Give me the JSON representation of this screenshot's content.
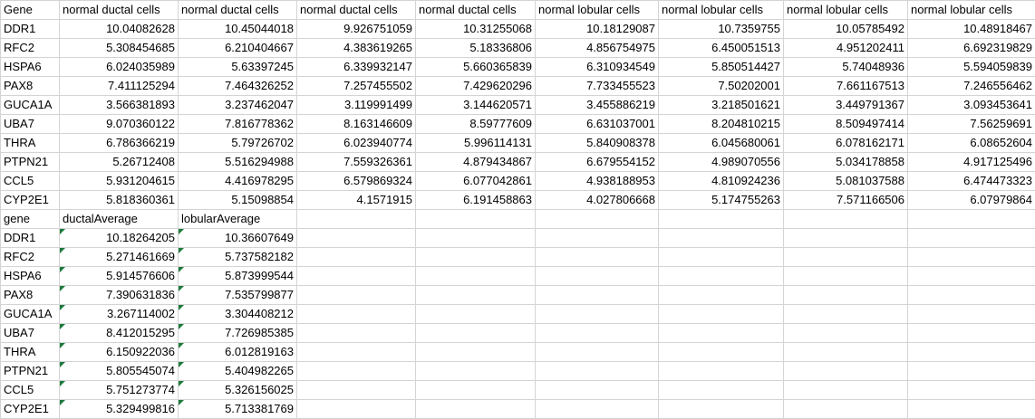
{
  "sheet": {
    "header_row": [
      "Gene",
      "normal ductal cells",
      "normal ductal cells",
      "normal ductal cells",
      "normal ductal cells",
      "normal lobular cells",
      "normal lobular cells",
      "normal lobular cells",
      "normal lobular cells"
    ],
    "rows": [
      [
        "DDR1",
        "10.04082628",
        "10.45044018",
        "9.926751059",
        "10.31255068",
        "10.18129087",
        "10.7359755",
        "10.05785492",
        "10.48918467"
      ],
      [
        "RFC2",
        "5.308454685",
        "6.210404667",
        "4.383619265",
        "5.18336806",
        "4.856754975",
        "6.450051513",
        "4.951202411",
        "6.692319829"
      ],
      [
        "HSPA6",
        "6.024035989",
        "5.63397245",
        "6.339932147",
        "5.660365839",
        "6.310934549",
        "5.850514427",
        "5.74048936",
        "5.594059839"
      ],
      [
        "PAX8",
        "7.411125294",
        "7.464326252",
        "7.257455502",
        "7.429620296",
        "7.733455523",
        "7.50202001",
        "7.661167513",
        "7.246556462"
      ],
      [
        "GUCA1A",
        "3.566381893",
        "3.237462047",
        "3.119991499",
        "3.144620571",
        "3.455886219",
        "3.218501621",
        "3.449791367",
        "3.093453641"
      ],
      [
        "UBA7",
        "9.070360122",
        "7.816778362",
        "8.163146609",
        "8.59777609",
        "6.631037001",
        "8.204810215",
        "8.509497414",
        "7.56259691"
      ],
      [
        "THRA",
        "6.786366219",
        "5.79726702",
        "6.023940774",
        "5.996114131",
        "5.840908378",
        "6.045680061",
        "6.078162171",
        "6.08652604"
      ],
      [
        "PTPN21",
        "5.26712408",
        "5.516294988",
        "7.559326361",
        "4.879434867",
        "6.679554152",
        "4.989070556",
        "5.034178858",
        "4.917125496"
      ],
      [
        "CCL5",
        "5.931204615",
        "4.416978295",
        "6.579869324",
        "6.077042861",
        "4.938188953",
        "4.810924236",
        "5.081037588",
        "6.474473323"
      ],
      [
        "CYP2E1",
        "5.818360361",
        "5.15098854",
        "4.1571915",
        "6.191458863",
        "4.027806668",
        "5.174755263",
        "7.571166506",
        "6.07979864"
      ]
    ],
    "summary_header": [
      "gene",
      "ductalAverage",
      "lobularAverage"
    ],
    "summary_rows": [
      [
        "DDR1",
        "10.18264205",
        "10.36607649"
      ],
      [
        "RFC2",
        "5.271461669",
        "5.737582182"
      ],
      [
        "HSPA6",
        "5.914576606",
        "5.873999544"
      ],
      [
        "PAX8",
        "7.390631836",
        "7.535799877"
      ],
      [
        "GUCA1A",
        "3.267114002",
        "3.304408212"
      ],
      [
        "UBA7",
        "8.412015295",
        "7.726985385"
      ],
      [
        "THRA",
        "6.150922036",
        "6.012819163"
      ],
      [
        "PTPN21",
        "5.805545074",
        "5.404982265"
      ],
      [
        "CCL5",
        "5.751273774",
        "5.326156025"
      ],
      [
        "CYP2E1",
        "5.329499816",
        "5.713381769"
      ]
    ],
    "colors": {
      "gridline": "#d4d4d4",
      "error_flag": "#1e7a3c"
    }
  }
}
